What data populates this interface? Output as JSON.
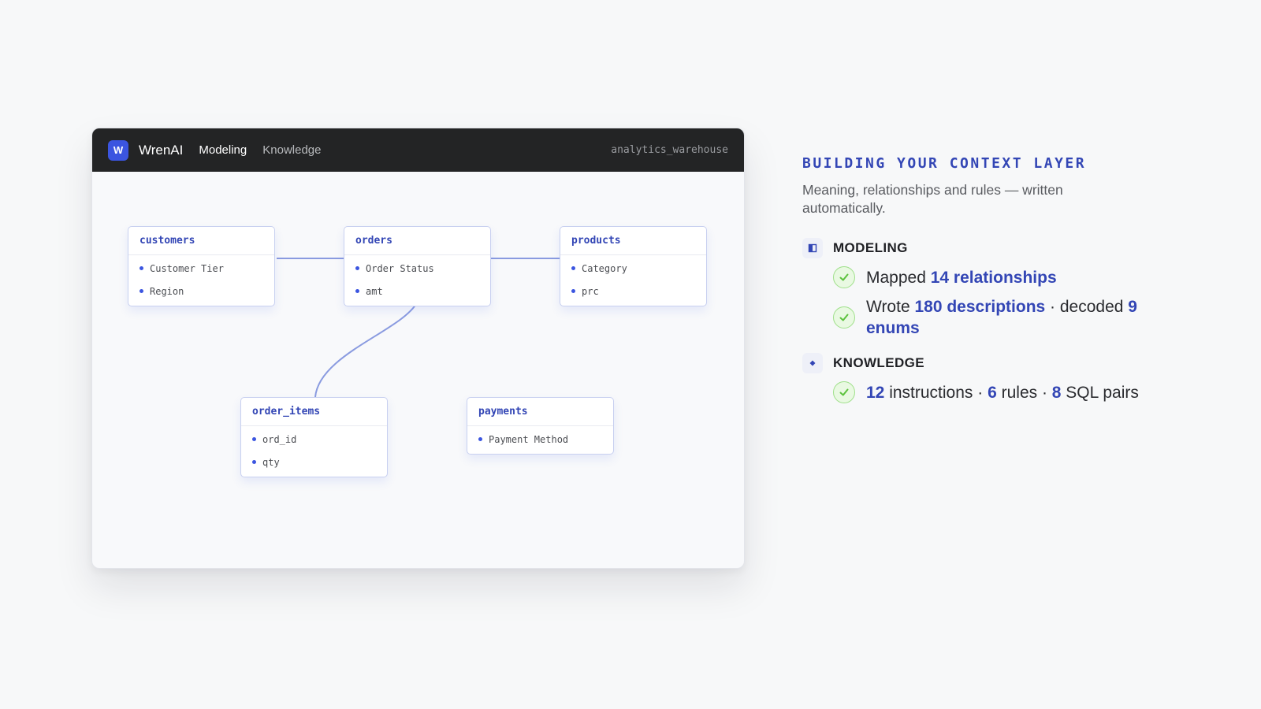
{
  "app": {
    "logo_letter": "W",
    "name": "WrenAI",
    "tabs": [
      {
        "label": "Modeling",
        "active": true
      },
      {
        "label": "Knowledge",
        "active": false
      }
    ],
    "database": "analytics_warehouse"
  },
  "tables": [
    {
      "name": "customers",
      "columns": [
        "Customer Tier",
        "Region"
      ]
    },
    {
      "name": "orders",
      "columns": [
        "Order Status",
        "amt"
      ]
    },
    {
      "name": "products",
      "columns": [
        "Category",
        "prc"
      ]
    },
    {
      "name": "order_items",
      "columns": [
        "ord_id",
        "qty"
      ]
    },
    {
      "name": "payments",
      "columns": [
        "Payment Method"
      ]
    }
  ],
  "relationships": [
    {
      "from": "customers",
      "to": "orders"
    },
    {
      "from": "orders",
      "to": "products"
    },
    {
      "from": "orders",
      "to": "order_items"
    }
  ],
  "panel": {
    "heading": "BUILDING YOUR CONTEXT LAYER",
    "subtitle": "Meaning, relationships and rules — written automatically.",
    "modeling": {
      "title": "MODELING",
      "icon": "modeling-icon",
      "items": [
        {
          "prefix": "Mapped ",
          "rel_value": "14 relationships"
        },
        {
          "prefix": "Wrote ",
          "desc_value": "180 descriptions",
          "mid": " · decoded ",
          "enum_value": "9 enums"
        }
      ]
    },
    "knowledge": {
      "title": "KNOWLEDGE",
      "icon": "diamond-icon",
      "item": {
        "instructions_count": "12",
        "instructions_label": " instructions · ",
        "rules_count": "6",
        "rules_label": " rules · ",
        "sql_count": "8",
        "sql_label": " SQL pairs"
      }
    }
  },
  "colors": {
    "accent": "#3346b5",
    "logo_bg": "#3b55e0",
    "titlebar": "#232425",
    "check_green": "#5cc23d"
  }
}
